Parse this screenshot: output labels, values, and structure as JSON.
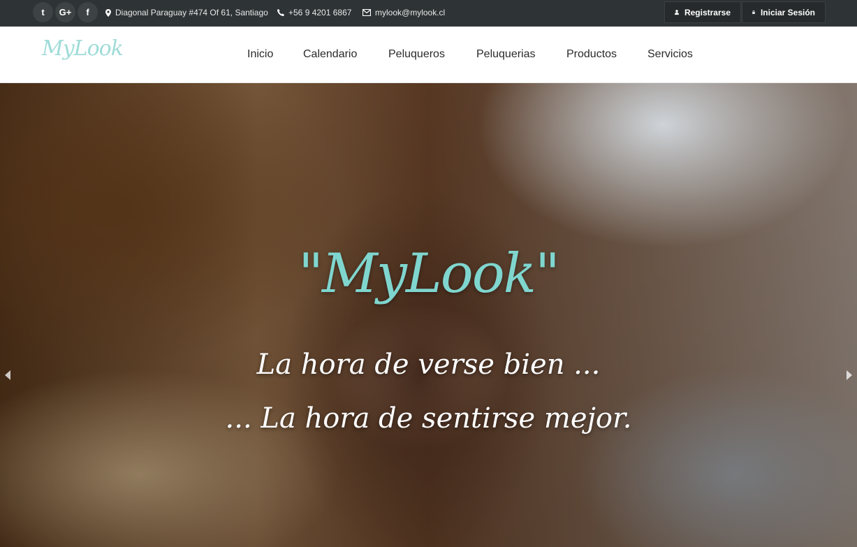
{
  "topbar": {
    "social": [
      {
        "name": "twitter-icon",
        "glyph": "t"
      },
      {
        "name": "google-plus-icon",
        "glyph": "G+"
      },
      {
        "name": "facebook-icon",
        "glyph": "f"
      }
    ],
    "address": "Diagonal  Paraguay #474 Of 61, Santiago",
    "phone": "+56 9 4201 6867",
    "email": "mylook@mylook.cl",
    "register_label": "Registrarse",
    "login_label": "Iniciar Sesión"
  },
  "nav": {
    "logo": "MyLook",
    "items": [
      "Inicio",
      "Calendario",
      "Peluqueros",
      "Peluquerias",
      "Productos",
      "Servicios"
    ]
  },
  "hero": {
    "title": "\"MyLook\"",
    "line1": "La hora de verse bien ...",
    "line2": "... La hora de sentirse mejor."
  },
  "colors": {
    "topbar_bg": "#2e3335",
    "logo_accent": "#7fd6cf"
  }
}
